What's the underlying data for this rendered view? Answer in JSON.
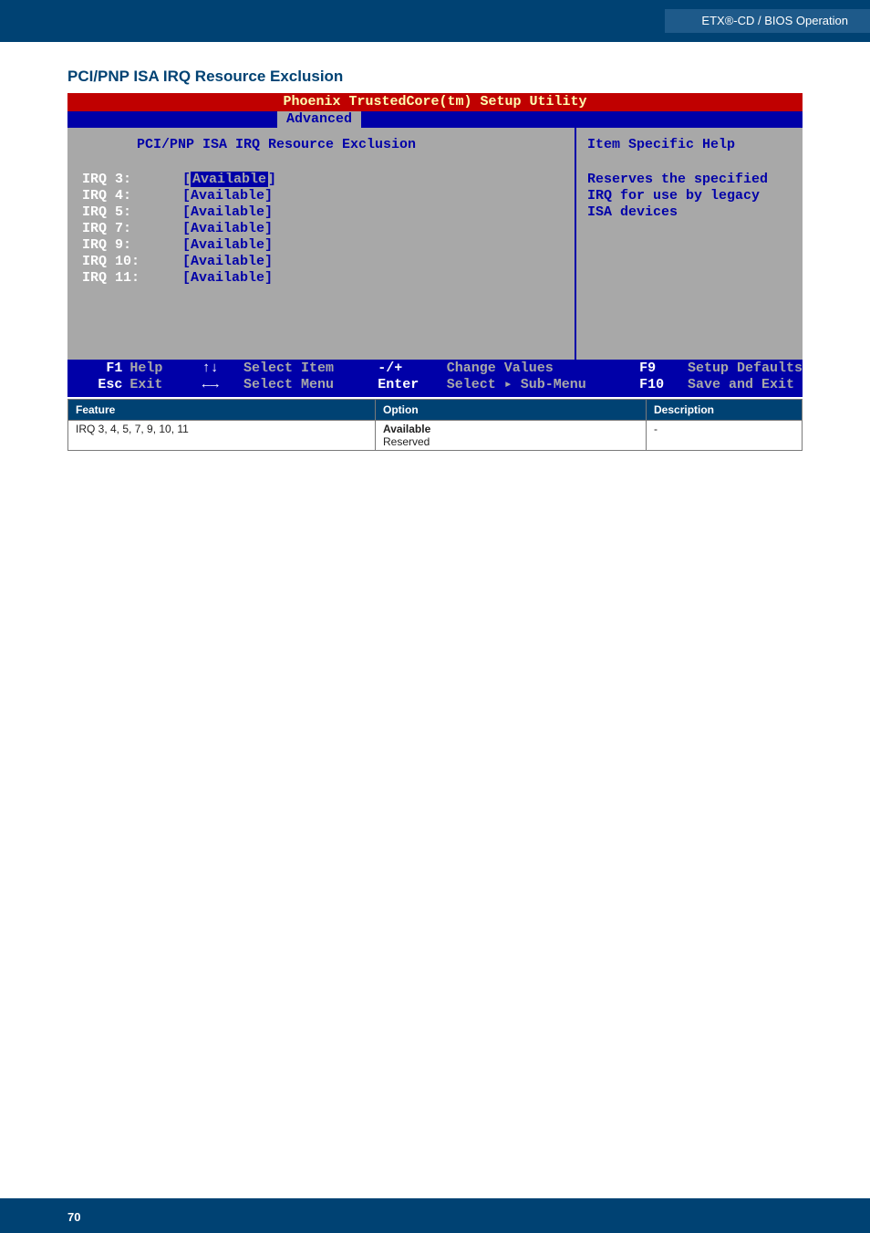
{
  "header": {
    "breadcrumb": "ETX®-CD / BIOS Operation"
  },
  "section_title": "PCI/PNP ISA IRQ Resource Exclusion",
  "bios": {
    "utility_title": "Phoenix TrustedCore(tm) Setup Utility",
    "active_tab": "Advanced",
    "page_title": "PCI/PNP ISA IRQ Resource Exclusion",
    "help_title": "Item Specific Help",
    "help_text_1": "Reserves the specified",
    "help_text_2": "IRQ for use by legacy",
    "help_text_3": "ISA devices",
    "irqs": [
      {
        "label": "IRQ  3:",
        "value": "Available",
        "selected": true
      },
      {
        "label": "IRQ  4:",
        "value": "[Available]",
        "selected": false
      },
      {
        "label": "IRQ  5:",
        "value": "[Available]",
        "selected": false
      },
      {
        "label": "IRQ  7:",
        "value": "[Available]",
        "selected": false
      },
      {
        "label": "IRQ  9:",
        "value": "[Available]",
        "selected": false
      },
      {
        "label": "IRQ 10:",
        "value": "[Available]",
        "selected": false
      },
      {
        "label": "IRQ 11:",
        "value": "[Available]",
        "selected": false
      }
    ],
    "footer": {
      "f1": "F1",
      "help": "Help",
      "esc": "Esc",
      "exit": "Exit",
      "updown": "↑↓",
      "select_item": "Select Item",
      "leftright": "←→",
      "select_menu": "Select Menu",
      "minusplus": "-/+",
      "change_values": "Change Values",
      "enter": "Enter",
      "select_sub": "Select ▸ Sub-Menu",
      "f9": "F9",
      "setup_defaults": "Setup Defaults",
      "f10": "F10",
      "save_exit": "Save and Exit"
    }
  },
  "table": {
    "headers": {
      "feature": "Feature",
      "option": "Option",
      "description": "Description"
    },
    "row": {
      "feature": "IRQ 3, 4, 5, 7, 9, 10, 11",
      "opt1": "Available",
      "opt2": "Reserved",
      "description": "-"
    }
  },
  "page_number": "70"
}
